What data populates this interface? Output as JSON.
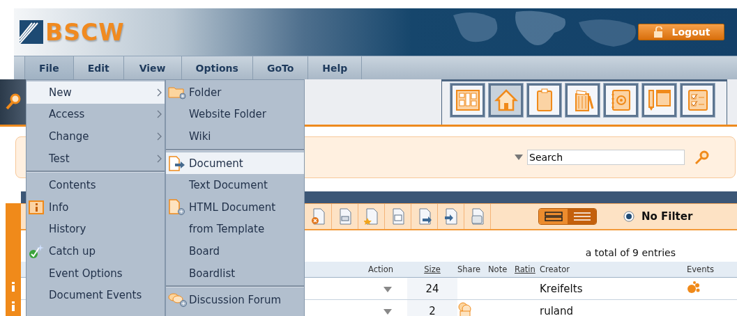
{
  "header": {
    "logo": "BSCW",
    "logout": "Logout"
  },
  "menubar": [
    {
      "label": "File",
      "selected": true
    },
    {
      "label": "Edit",
      "selected": false
    },
    {
      "label": "View",
      "selected": false
    },
    {
      "label": "Options",
      "selected": false
    },
    {
      "label": "GoTo",
      "selected": false
    },
    {
      "label": "Help",
      "selected": false
    }
  ],
  "file_menu": {
    "sections": [
      [
        {
          "label": "New",
          "kind": "plain",
          "submenu": true,
          "selected": true
        },
        {
          "label": "Access",
          "kind": "plain",
          "submenu": true,
          "selected": false
        },
        {
          "label": "Change",
          "kind": "plain",
          "submenu": true,
          "selected": false
        },
        {
          "label": "Test",
          "kind": "plain",
          "submenu": true,
          "selected": false
        }
      ],
      [
        {
          "label": "Contents",
          "kind": "plain",
          "submenu": false,
          "selected": false
        },
        {
          "label": "Info",
          "kind": "info",
          "submenu": false,
          "selected": false
        },
        {
          "label": "History",
          "kind": "plain",
          "submenu": false,
          "selected": false
        },
        {
          "label": "Catch up",
          "kind": "catchup",
          "submenu": false,
          "selected": false
        },
        {
          "label": "Event Options",
          "kind": "plain",
          "submenu": false,
          "selected": false
        },
        {
          "label": "Document Events",
          "kind": "plain",
          "submenu": false,
          "selected": false
        }
      ]
    ]
  },
  "new_submenu": {
    "sections": [
      [
        {
          "label": "Folder",
          "kind": "folder",
          "selected": false
        },
        {
          "label": "Website Folder",
          "kind": "plain",
          "selected": false
        },
        {
          "label": "Wiki",
          "kind": "plain",
          "selected": false
        }
      ],
      [
        {
          "label": "Document",
          "kind": "document",
          "selected": true
        },
        {
          "label": "Text Document",
          "kind": "plain",
          "selected": false
        },
        {
          "label": "HTML Document",
          "kind": "newdoc",
          "selected": false
        },
        {
          "label": "from Template",
          "kind": "plain",
          "selected": false
        },
        {
          "label": "Board",
          "kind": "plain",
          "selected": false
        },
        {
          "label": "Boardlist",
          "kind": "plain",
          "selected": false
        }
      ],
      [
        {
          "label": "Discussion Forum",
          "kind": "forum",
          "selected": false
        }
      ]
    ]
  },
  "view_tabs": [
    {
      "kind": "board",
      "selected": false
    },
    {
      "kind": "home",
      "selected": true
    },
    {
      "kind": "clipboard",
      "selected": false
    },
    {
      "kind": "trash",
      "selected": false
    },
    {
      "kind": "addressbook",
      "selected": false
    },
    {
      "kind": "calendar",
      "selected": false
    },
    {
      "kind": "tasks",
      "selected": false
    }
  ],
  "search": {
    "value": "Search"
  },
  "toolbar": {
    "display_modes": [
      {
        "kind": "compact",
        "selected": false
      },
      {
        "kind": "list",
        "selected": true
      }
    ],
    "filter": {
      "label": "No Filter",
      "selected": true
    }
  },
  "summary": "a total of 9 entries",
  "table": {
    "columns": [
      {
        "label": "Action",
        "sortable": false
      },
      {
        "label": "Size",
        "sortable": true
      },
      {
        "label": "Share",
        "sortable": false
      },
      {
        "label": "Note",
        "sortable": false
      },
      {
        "label": "Ratin",
        "sortable": true
      },
      {
        "label": "Creator",
        "sortable": false
      },
      {
        "label": "Events",
        "sortable": false
      }
    ],
    "rows": [
      {
        "size": "24",
        "shared": false,
        "creator": "Kreifelts",
        "events": true
      },
      {
        "size": "2",
        "shared": true,
        "creator": "ruland",
        "events": false
      }
    ]
  }
}
